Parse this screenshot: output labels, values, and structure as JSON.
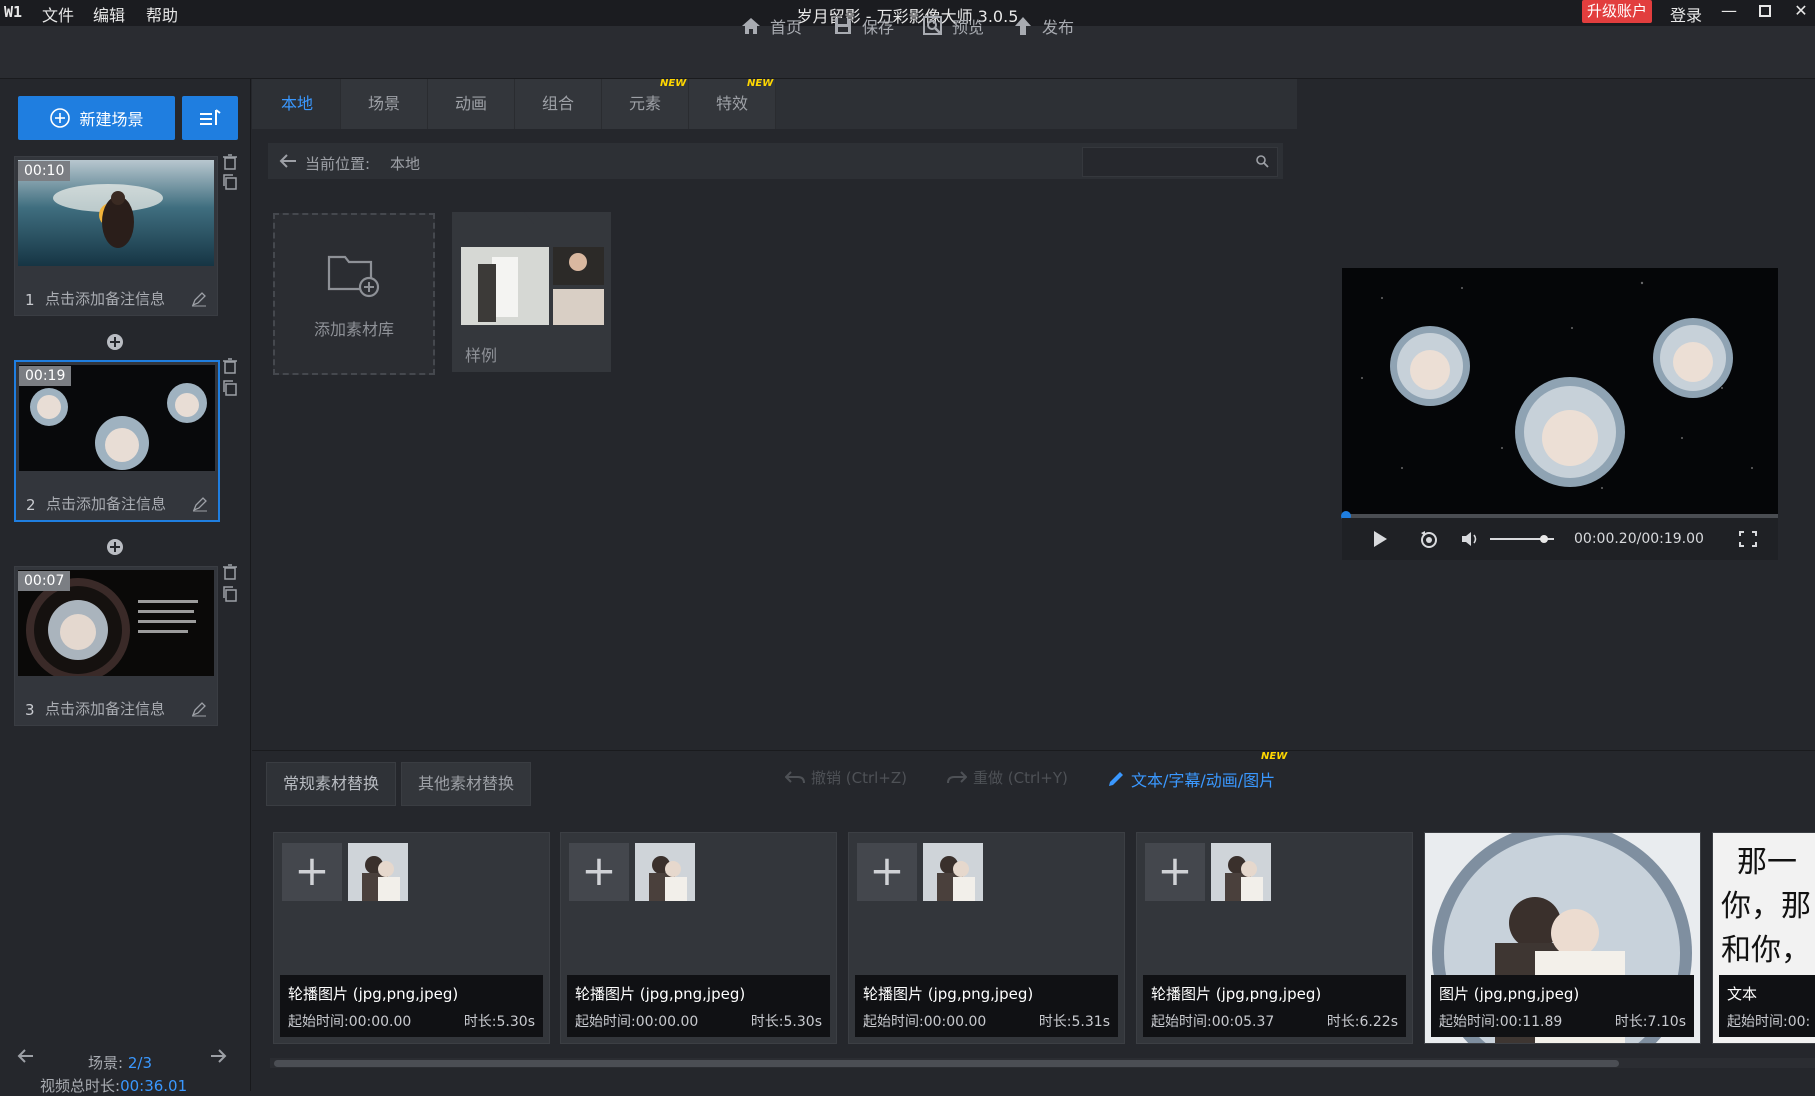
{
  "titlebar": {
    "logo": "W1",
    "menu": [
      "文件",
      "编辑",
      "帮助"
    ],
    "title": "岁月留影 - 万彩影像大师 3.0.5",
    "upgrade": "升级账户",
    "login": "登录"
  },
  "toolbar": {
    "home": "首页",
    "save": "保存",
    "preview": "预览",
    "publish": "发布"
  },
  "left": {
    "new_scene": "新建场景",
    "scenes": [
      {
        "index": "1",
        "duration": "00:10",
        "note": "点击添加备注信息"
      },
      {
        "index": "2",
        "duration": "00:19",
        "note": "点击添加备注信息"
      },
      {
        "index": "3",
        "duration": "00:07",
        "note": "点击添加备注信息"
      }
    ],
    "scene_count_label": "场景:",
    "scene_count_value": "2/3",
    "total_label": "视频总时长:",
    "total_value": "00:36.01"
  },
  "tabs": [
    {
      "label": "本地",
      "new": false
    },
    {
      "label": "场景",
      "new": false
    },
    {
      "label": "动画",
      "new": false
    },
    {
      "label": "组合",
      "new": false
    },
    {
      "label": "元素",
      "new": true
    },
    {
      "label": "特效",
      "new": true
    }
  ],
  "badge_new": "NEW",
  "breadcrumb": {
    "label": "当前位置:",
    "value": "本地"
  },
  "library": {
    "add_label": "添加素材库",
    "sample_label": "样例"
  },
  "player": {
    "timecode": "00:00.20/00:19.00",
    "progress": 0.01,
    "volume": 0.85
  },
  "bottom": {
    "tab_regular": "常规素材替换",
    "tab_other": "其他素材替换",
    "undo": "撤销 (Ctrl+Z)",
    "redo": "重做 (Ctrl+Y)",
    "text_sub": "文本/字幕/动画/图片",
    "cards": [
      {
        "title": "轮播图片 (jpg,png,jpeg)",
        "start": "起始时间:00:00.00",
        "dur": "时长:5.30s"
      },
      {
        "title": "轮播图片 (jpg,png,jpeg)",
        "start": "起始时间:00:00.00",
        "dur": "时长:5.30s"
      },
      {
        "title": "轮播图片 (jpg,png,jpeg)",
        "start": "起始时间:00:00.00",
        "dur": "时长:5.31s"
      },
      {
        "title": "轮播图片 (jpg,png,jpeg)",
        "start": "起始时间:00:05.37",
        "dur": "时长:6.22s"
      },
      {
        "title": "图片 (jpg,png,jpeg)",
        "start": "起始时间:00:11.89",
        "dur": "时长:7.10s"
      },
      {
        "title": "文本",
        "start": "起始时间:00:",
        "dur": "",
        "text_preview": [
          "那一",
          "你，那",
          "和你，"
        ]
      }
    ]
  },
  "colors": {
    "accent": "#1f7ee0",
    "accent_text": "#3a98ff",
    "upgrade": "#e23e3e",
    "new_badge": "#ffd700"
  }
}
